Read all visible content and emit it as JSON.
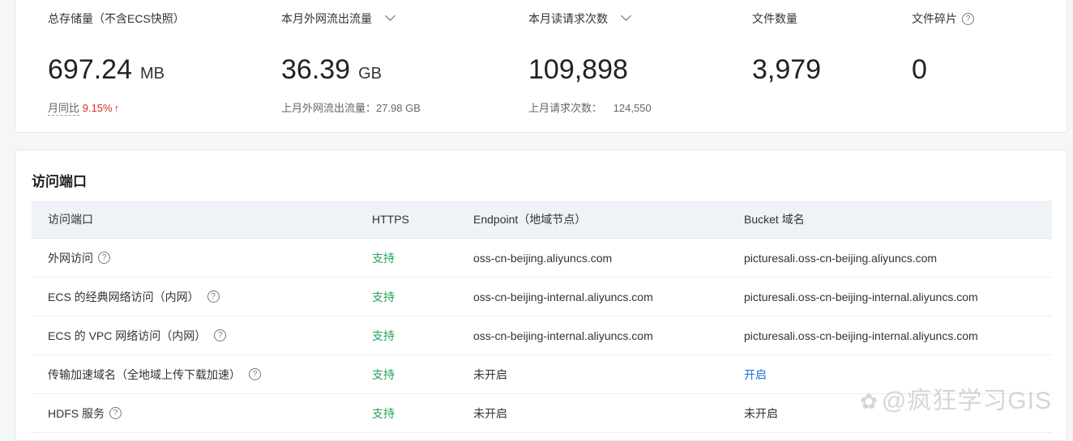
{
  "stats": {
    "storage": {
      "label": "总存储量（不含ECS快照）",
      "value": "697.24",
      "unit": "MB",
      "mom_label": "月同比",
      "mom_value": "9.15%",
      "mom_arrow": "↑"
    },
    "outbound_traffic": {
      "label": "本月外网流出流量",
      "value": "36.39",
      "unit": "GB",
      "sub": "上月外网流出流量：27.98 GB"
    },
    "read_requests": {
      "label": "本月读请求次数",
      "value": "109,898",
      "sub_label": "上月请求次数：",
      "sub_value": "124,550"
    },
    "file_count": {
      "label": "文件数量",
      "value": "3,979"
    },
    "fragments": {
      "label": "文件碎片",
      "value": "0"
    }
  },
  "endpoints": {
    "title": "访问端口",
    "headers": [
      "访问端口",
      "HTTPS",
      "Endpoint（地域节点）",
      "Bucket 域名"
    ],
    "rows": [
      {
        "name": "外网访问",
        "https": "支持",
        "endpoint": "oss-cn-beijing.aliyuncs.com",
        "bucket": "picturesali.oss-cn-beijing.aliyuncs.com"
      },
      {
        "name": "ECS 的经典网络访问（内网）",
        "https": "支持",
        "endpoint": "oss-cn-beijing-internal.aliyuncs.com",
        "bucket": "picturesali.oss-cn-beijing-internal.aliyuncs.com"
      },
      {
        "name": "ECS 的 VPC 网络访问（内网）",
        "https": "支持",
        "endpoint": "oss-cn-beijing-internal.aliyuncs.com",
        "bucket": "picturesali.oss-cn-beijing-internal.aliyuncs.com"
      },
      {
        "name": "传输加速域名（全地域上传下载加速）",
        "https": "支持",
        "endpoint": "未开启",
        "bucket": "开启"
      },
      {
        "name": "HDFS 服务",
        "https": "支持",
        "endpoint": "未开启",
        "bucket": "未开启"
      }
    ]
  },
  "watermark": "@疯狂学习GIS",
  "colors": {
    "green": "#23a356",
    "link": "#1f6fd8",
    "red": "#d93026",
    "header_bg": "#eff2f6"
  },
  "icons": [
    "chevron-down-icon",
    "question-circle-icon",
    "arrow-up-icon"
  ]
}
